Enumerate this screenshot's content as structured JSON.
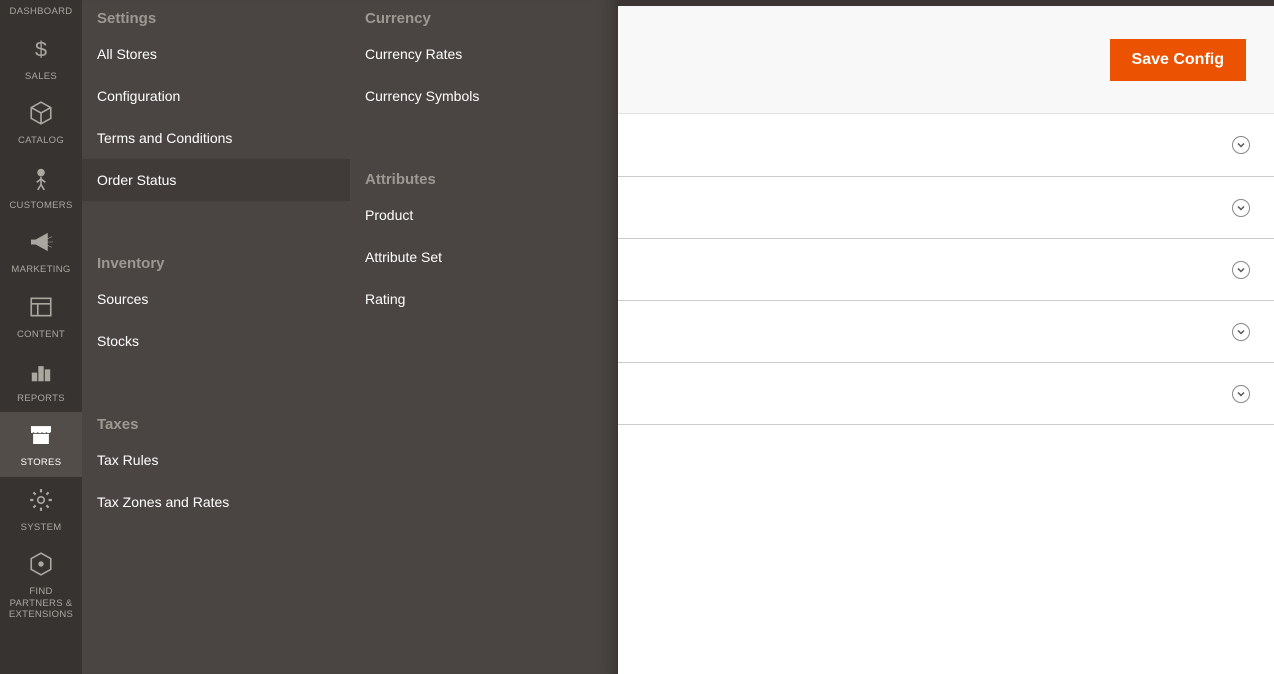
{
  "sidebar": {
    "items": [
      {
        "label": "DASHBOARD"
      },
      {
        "label": "SALES"
      },
      {
        "label": "CATALOG"
      },
      {
        "label": "CUSTOMERS"
      },
      {
        "label": "MARKETING"
      },
      {
        "label": "CONTENT"
      },
      {
        "label": "REPORTS"
      },
      {
        "label": "STORES"
      },
      {
        "label": "SYSTEM"
      },
      {
        "label": "FIND PARTNERS & EXTENSIONS"
      }
    ]
  },
  "flyout": {
    "col1": {
      "settings_title": "Settings",
      "settings_items": [
        "All Stores",
        "Configuration",
        "Terms and Conditions",
        "Order Status"
      ],
      "inventory_title": "Inventory",
      "inventory_items": [
        "Sources",
        "Stocks"
      ],
      "taxes_title": "Taxes",
      "taxes_items": [
        "Tax Rules",
        "Tax Zones and Rates"
      ]
    },
    "col2": {
      "currency_title": "Currency",
      "currency_items": [
        "Currency Rates",
        "Currency Symbols"
      ],
      "attributes_title": "Attributes",
      "attributes_items": [
        "Product",
        "Attribute Set",
        "Rating"
      ]
    }
  },
  "main": {
    "save_label": "Save Config"
  }
}
